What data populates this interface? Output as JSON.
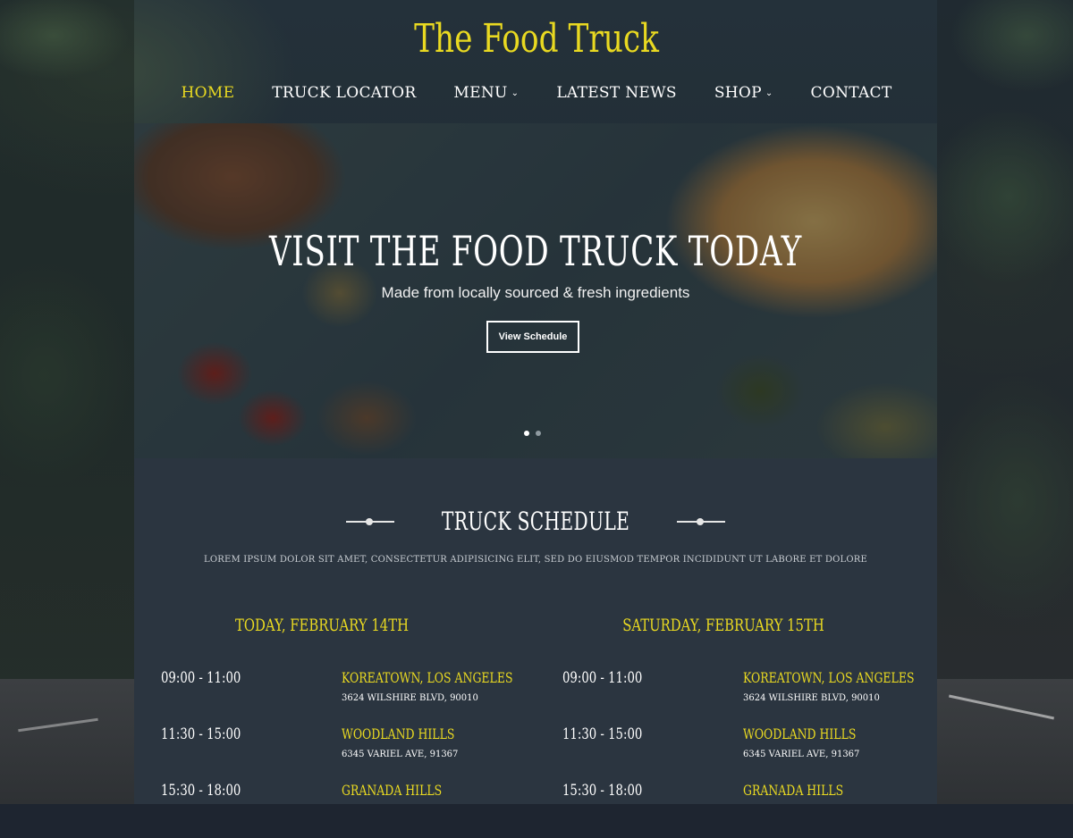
{
  "brand": {
    "title": "The Food Truck"
  },
  "nav": {
    "items": [
      {
        "label": "Home",
        "active": true
      },
      {
        "label": "Truck Locator"
      },
      {
        "label": "Menu",
        "dropdown": true
      },
      {
        "label": "Latest News"
      },
      {
        "label": "Shop",
        "dropdown": true
      },
      {
        "label": "Contact"
      }
    ]
  },
  "hero": {
    "title": "Visit The Food Truck Today",
    "subtitle": "Made from locally sourced & fresh ingredients",
    "button_label": "View Schedule",
    "slides": 2,
    "active_slide": 1
  },
  "schedule": {
    "title": "Truck Schedule",
    "description": "Lorem ipsum dolor sit amet, consectetur adipisicing elit, sed do eiusmod tempor incididunt ut labore et dolore",
    "days": [
      {
        "title": "Today, February 14th",
        "slots": [
          {
            "time": "09:00 - 11:00",
            "place": "Koreatown, Los Angeles",
            "address": "3624 Wilshire Blvd, 90010"
          },
          {
            "time": "11:30 - 15:00",
            "place": "Woodland Hills",
            "address": "6345 Variel Ave, 91367"
          },
          {
            "time": "15:30 - 18:00",
            "place": "Granada Hills",
            "address": ""
          }
        ]
      },
      {
        "title": "Saturday, February 15th",
        "slots": [
          {
            "time": "09:00 - 11:00",
            "place": "Koreatown, Los Angeles",
            "address": "3624 Wilshire Blvd, 90010"
          },
          {
            "time": "11:30 - 15:00",
            "place": "Woodland Hills",
            "address": "6345 Variel Ave, 91367"
          },
          {
            "time": "15:30 - 18:00",
            "place": "Granada Hills",
            "address": ""
          }
        ]
      }
    ]
  },
  "colors": {
    "accent": "#e9d921",
    "panel": "#2b3540",
    "text": "#ffffff"
  }
}
